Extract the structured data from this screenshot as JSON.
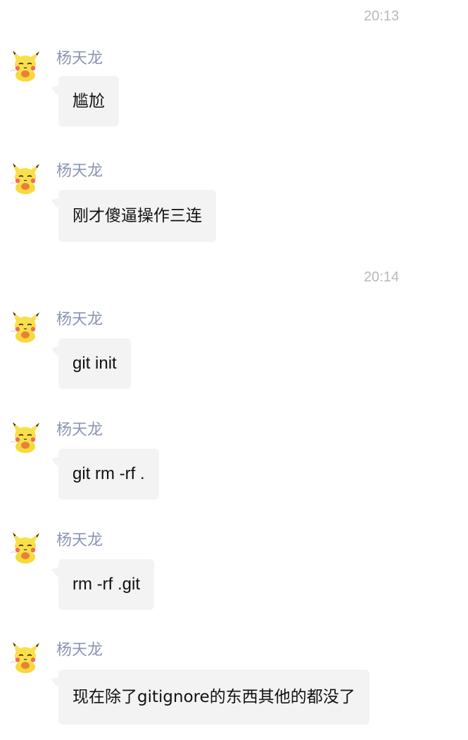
{
  "chat": {
    "items": [
      {
        "type": "timestamp",
        "text": "20:13"
      },
      {
        "type": "message",
        "sender": "杨天龙",
        "text": "尴尬"
      },
      {
        "type": "message",
        "sender": "杨天龙",
        "text": "刚才傻逼操作三连"
      },
      {
        "type": "timestamp",
        "text": "20:14"
      },
      {
        "type": "message",
        "sender": "杨天龙",
        "text": "git init"
      },
      {
        "type": "message",
        "sender": "杨天龙",
        "text": "git rm -rf ."
      },
      {
        "type": "message",
        "sender": "杨天龙",
        "text": "rm -rf .git"
      },
      {
        "type": "message",
        "sender": "杨天龙",
        "text": "现在除了gitignore的东西其他的都没了"
      }
    ]
  },
  "icons": {
    "avatar": "pikachu-avatar-icon"
  },
  "colors": {
    "background": "#ffffff",
    "bubble": "#f3f3f3",
    "sender_name": "#8a94b3",
    "timestamp": "#b8b8b8",
    "message_text": "#111111"
  }
}
